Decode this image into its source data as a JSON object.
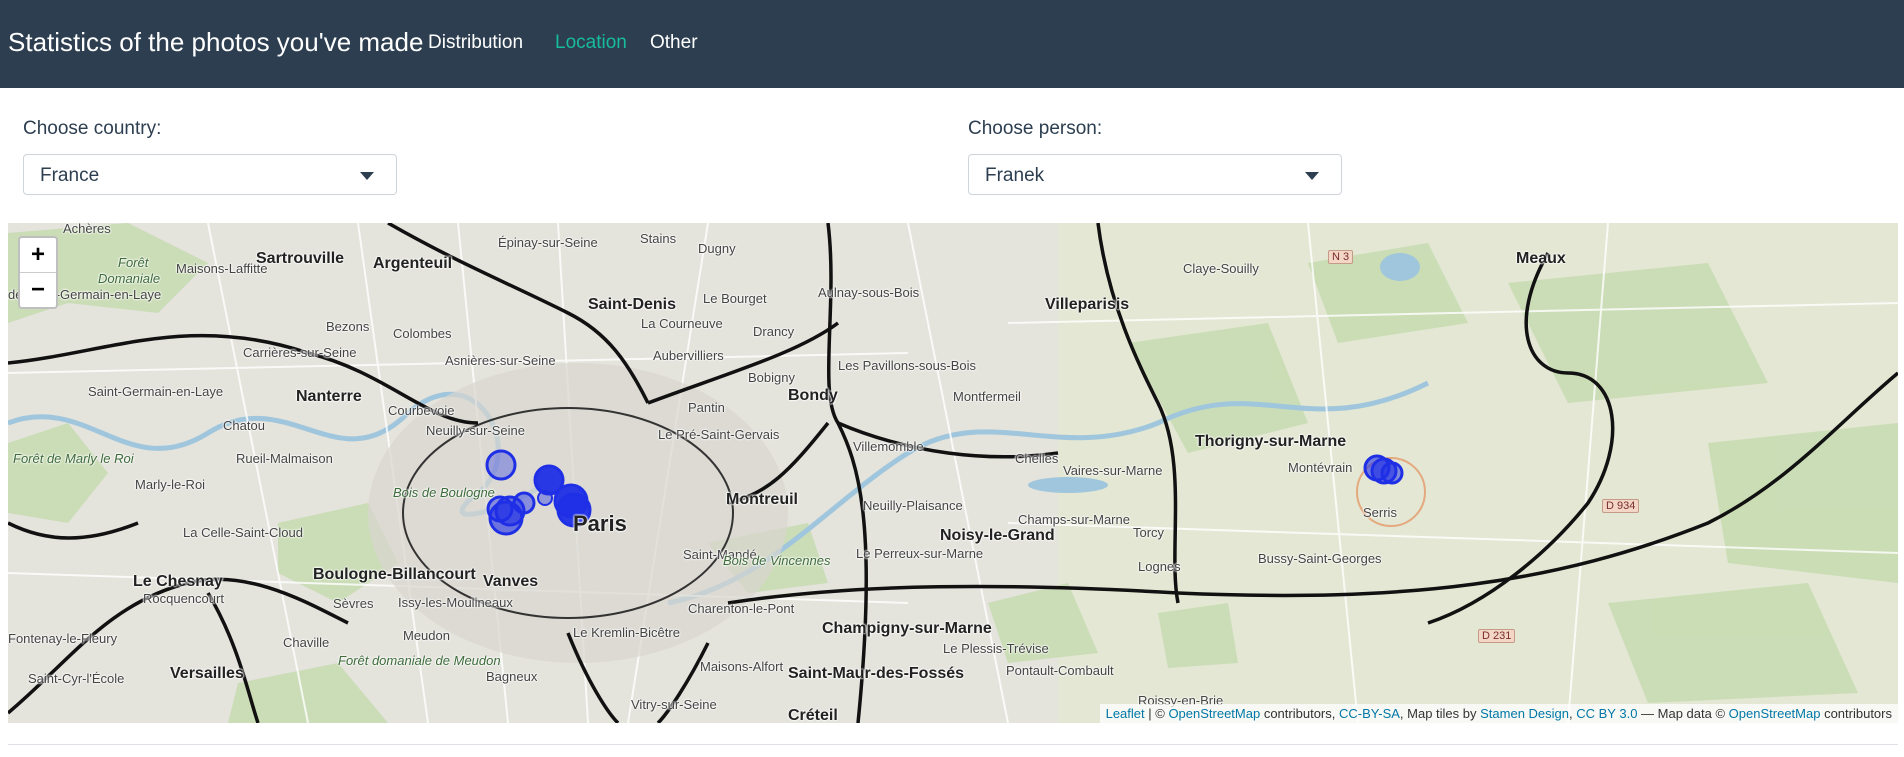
{
  "navbar": {
    "brand": "Statistics of the photos you've made",
    "links": [
      {
        "label": "Distribution",
        "active": false
      },
      {
        "label": "Location",
        "active": true
      },
      {
        "label": "Other",
        "active": false
      }
    ]
  },
  "filters": {
    "country": {
      "label": "Choose country:",
      "value": "France"
    },
    "person": {
      "label": "Choose person:",
      "value": "Franek"
    }
  },
  "map": {
    "zoom_in": "+",
    "zoom_out": "−",
    "places": [
      "Achères",
      "Forêt",
      "Domaniale",
      "de Saint-Germain-en-Laye",
      "Maisons-Laffitte",
      "Sartrouville",
      "Argenteuil",
      "Épinay-sur-Seine",
      "Stains",
      "Dugny",
      "Saint-Denis",
      "Le Bourget",
      "Aulnay-sous-Bois",
      "Villeparisis",
      "Claye-Souilly",
      "Meaux",
      "Bezons",
      "Colombes",
      "La Courneuve",
      "Drancy",
      "Carrières-sur-Seine",
      "Asnières-sur-Seine",
      "Aubervilliers",
      "Saint-Germain-en-Laye",
      "Nanterre",
      "Pantin",
      "Bobigny",
      "Les Pavillons-sous-Bois",
      "Bondy",
      "Montfermeil",
      "Chatou",
      "Courbevoie",
      "Le Pré-Saint-Gervais",
      "Rueil-Malmaison",
      "Neuilly-sur-Seine",
      "Villemomble",
      "Chelles",
      "Vaires-sur-Marne",
      "Thorigny-sur-Marne",
      "Montévrain",
      "Forêt de Marly le Roi",
      "Marly-le-Roi",
      "Bois de Boulogne",
      "Paris",
      "Montreuil",
      "Neuilly-Plaisance",
      "Champs-sur-Marne",
      "Torcy",
      "Serris",
      "Noisy-le-Grand",
      "La Celle-Saint-Cloud",
      "Saint-Mandé",
      "Bussy-Saint-Georges",
      "Le Chesnay",
      "Rocquencourt",
      "Boulogne-Billancourt",
      "Vanves",
      "Le Perreux-sur-Marne",
      "Lognes",
      "Bois de Vincennes",
      "Sèvres",
      "Issy-les-Moulineaux",
      "Charenton-le-Pont",
      "Champigny-sur-Marne",
      "Chaville",
      "Meudon",
      "Le Kremlin-Bicêtre",
      "Le Plessis-Trévise",
      "Fontenay-le-Fleury",
      "Versailles",
      "Forêt domaniale de Meudon",
      "Bagneux",
      "Maisons-Alfort",
      "Saint-Maur-des-Fossés",
      "Pontault-Combault",
      "Saint-Cyr-l'École",
      "Vitry-sur-Seine",
      "Créteil",
      "Roissy-en-Brie"
    ],
    "road_labels": [
      "N 3",
      "D 934",
      "D 231"
    ],
    "markers_count": 12,
    "marker_color": "#1f2fe6",
    "attribution": {
      "leaflet": "Leaflet",
      "sep1": " | © ",
      "osm": "OpenStreetMap",
      "contrib": " contributors, ",
      "ccbysa": "CC-BY-SA",
      "tiles": ", Map tiles by ",
      "stamen": "Stamen Design",
      "comma": ", ",
      "ccby": "CC BY 3.0",
      "mapdata": " — Map data © ",
      "osm2": "OpenStreetMap",
      "contrib2": " contributors"
    }
  }
}
